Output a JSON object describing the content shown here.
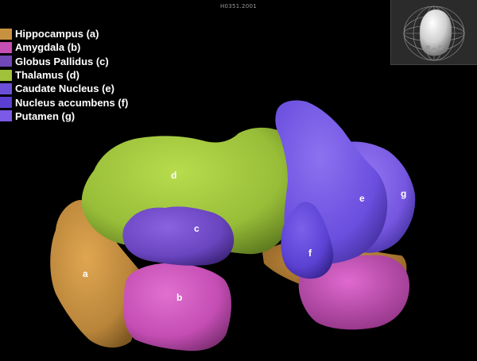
{
  "scan_id": "H0351.2001",
  "legend": [
    {
      "label": "Hippocampus (a)",
      "color": "#c8913f"
    },
    {
      "label": "Amygdala (b)",
      "color": "#c54fb5"
    },
    {
      "label": "Globus Pallidus (c)",
      "color": "#7048b8"
    },
    {
      "label": "Thalamus (d)",
      "color": "#9fc23a"
    },
    {
      "label": "Caudate Nucleus (e)",
      "color": "#6b4fd6"
    },
    {
      "label": "Nucleus accumbens (f)",
      "color": "#5a3fd0"
    },
    {
      "label": "Putamen (g)",
      "color": "#7a5ae6"
    }
  ],
  "regions": {
    "a": "a",
    "b": "b",
    "c": "c",
    "d": "d",
    "e": "e",
    "f": "f",
    "g": "g"
  },
  "colors": {
    "hippocampus": "#c08a3c",
    "amygdala": "#c44db3",
    "globus_pallidus": "#6a45c0",
    "thalamus": "#98bd38",
    "caudate": "#6a4ede",
    "accumbens": "#5c42d4",
    "putamen": "#7556e0"
  }
}
